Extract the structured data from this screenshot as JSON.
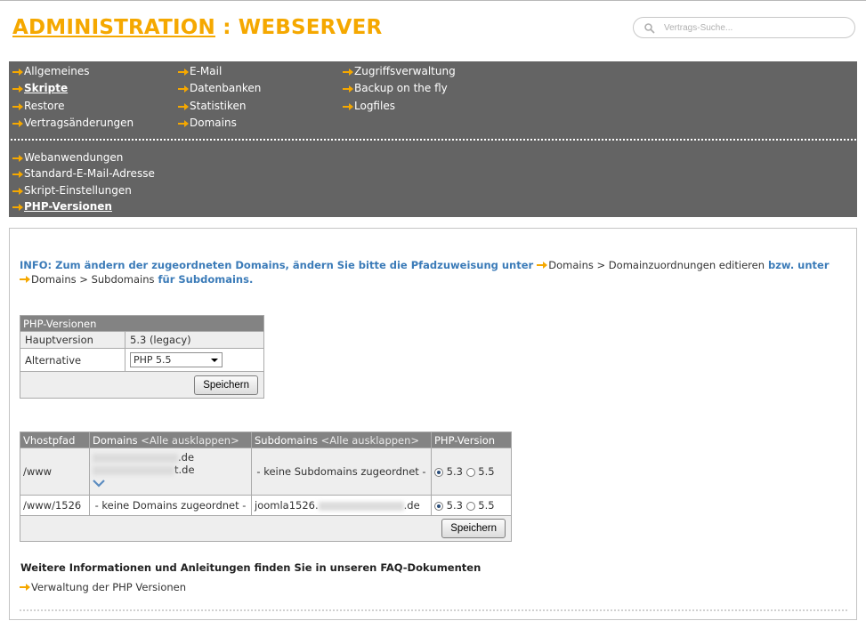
{
  "header": {
    "title_link": "ADMINISTRATION",
    "title_rest": " : WEBSERVER",
    "search_placeholder": "Vertrags-Suche..."
  },
  "nav": {
    "col1": [
      "Allgemeines",
      "Skripte",
      "Restore",
      "Vertragsänderungen"
    ],
    "col2": [
      "E-Mail",
      "Datenbanken",
      "Statistiken",
      "Domains"
    ],
    "col3": [
      "Zugriffsverwaltung",
      "Backup on the fly",
      "Logfiles"
    ],
    "sub": [
      "Webanwendungen",
      "Standard-E-Mail-Adresse",
      "Skript-Einstellungen",
      "PHP-Versionen"
    ]
  },
  "info": {
    "part1": "INFO: Zum ändern der zugeordneten Domains, ändern Sie bitte die Pfadzuweisung unter",
    "path1": "Domains > Domainzuordnungen editieren",
    "part2": "bzw. unter",
    "path2": "Domains > Subdomains",
    "part3": "für Subdomains."
  },
  "php_versions": {
    "title": "PHP-Versionen",
    "main_label": "Hauptversion",
    "main_value": "5.3 (legacy)",
    "alt_label": "Alternative",
    "alt_selected": "PHP 5.5",
    "save": "Speichern"
  },
  "vhosts": {
    "headers": {
      "vhostpfad": "Vhostpfad",
      "domains": "Domains",
      "domains_toggle": "<Alle ausklappen>",
      "subdomains": "Subdomains",
      "subdomains_toggle": "<Alle ausklappen>",
      "php": "PHP-Version"
    },
    "row1": {
      "path": "/www",
      "domain1_suffix": ".de",
      "domain2_suffix": "t.de",
      "subdomains": "- keine Subdomains zugeordnet -",
      "opt1": "5.3",
      "opt2": "5.5"
    },
    "row2": {
      "path": "/www/1526",
      "domains": "- keine Domains zugeordnet -",
      "sub_prefix": "joomla1526.",
      "sub_suffix": ".de",
      "opt1": "5.3",
      "opt2": "5.5"
    },
    "save": "Speichern"
  },
  "faq": {
    "heading": "Weitere Informationen und Anleitungen finden Sie in unseren FAQ-Dokumenten",
    "link": "Verwaltung der PHP Versionen"
  },
  "colors": {
    "accent": "#f5a800",
    "nav_bg": "#646464",
    "info_blue": "#3b7bb8",
    "table_header": "#838383"
  }
}
